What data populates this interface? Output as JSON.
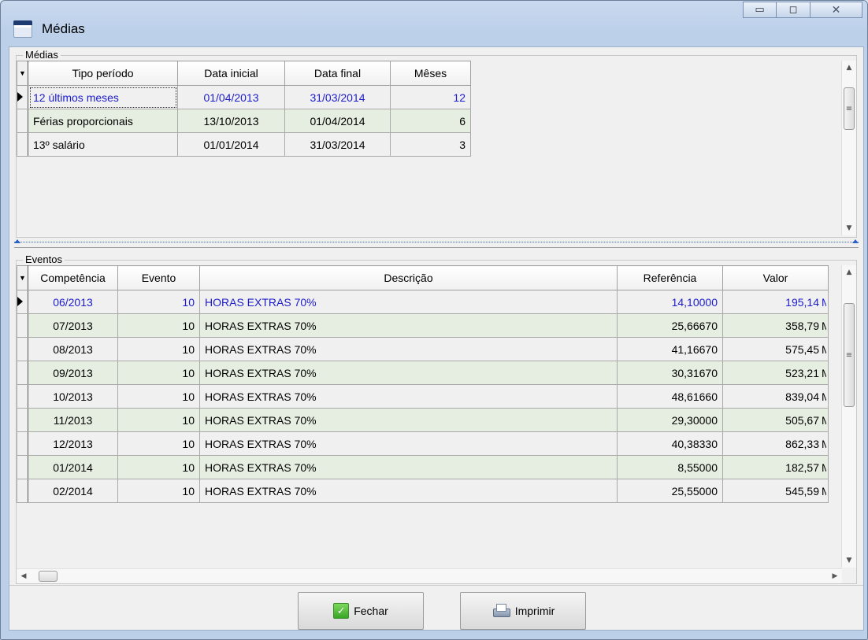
{
  "window": {
    "title": "Médias"
  },
  "caption": {
    "minimize": "▭",
    "maximize": "◻",
    "close": "✕"
  },
  "medias": {
    "legend": "Médias",
    "columns": [
      "Tipo período",
      "Data inicial",
      "Data final",
      "Mêses"
    ],
    "rows": [
      {
        "tipo": "12 últimos meses",
        "inicio": "01/04/2013",
        "fim": "31/03/2014",
        "meses": "12",
        "selected": true
      },
      {
        "tipo": "Férias proporcionais",
        "inicio": "13/10/2013",
        "fim": "01/04/2014",
        "meses": "6"
      },
      {
        "tipo": "13º salário",
        "inicio": "01/01/2014",
        "fim": "31/03/2014",
        "meses": "3"
      }
    ]
  },
  "eventos": {
    "legend": "Eventos",
    "columns": [
      "Competência",
      "Evento",
      "Descrição",
      "Referência",
      "Valor"
    ],
    "rows": [
      {
        "competencia": "06/2013",
        "evento": "10",
        "descricao": "HORAS EXTRAS 70%",
        "referencia": "14,10000",
        "valor": "195,14",
        "extra": "M"
      },
      {
        "competencia": "07/2013",
        "evento": "10",
        "descricao": "HORAS EXTRAS 70%",
        "referencia": "25,66670",
        "valor": "358,79",
        "extra": "M"
      },
      {
        "competencia": "08/2013",
        "evento": "10",
        "descricao": "HORAS EXTRAS 70%",
        "referencia": "41,16670",
        "valor": "575,45",
        "extra": "M"
      },
      {
        "competencia": "09/2013",
        "evento": "10",
        "descricao": "HORAS EXTRAS 70%",
        "referencia": "30,31670",
        "valor": "523,21",
        "extra": "M"
      },
      {
        "competencia": "10/2013",
        "evento": "10",
        "descricao": "HORAS EXTRAS 70%",
        "referencia": "48,61660",
        "valor": "839,04",
        "extra": "M"
      },
      {
        "competencia": "11/2013",
        "evento": "10",
        "descricao": "HORAS EXTRAS 70%",
        "referencia": "29,30000",
        "valor": "505,67",
        "extra": "M"
      },
      {
        "competencia": "12/2013",
        "evento": "10",
        "descricao": "HORAS EXTRAS 70%",
        "referencia": "40,38330",
        "valor": "862,33",
        "extra": "M"
      },
      {
        "competencia": "01/2014",
        "evento": "10",
        "descricao": "HORAS EXTRAS 70%",
        "referencia": "8,55000",
        "valor": "182,57",
        "extra": "M"
      },
      {
        "competencia": "02/2014",
        "evento": "10",
        "descricao": "HORAS EXTRAS 70%",
        "referencia": "25,55000",
        "valor": "545,59",
        "extra": "M"
      }
    ]
  },
  "buttons": {
    "fechar": "Fechar",
    "imprimir": "Imprimir"
  },
  "colors": {
    "selected_text": "#1c1ccb",
    "alt_row": "#e6eee1",
    "selection_frame": "#2a62c8"
  }
}
